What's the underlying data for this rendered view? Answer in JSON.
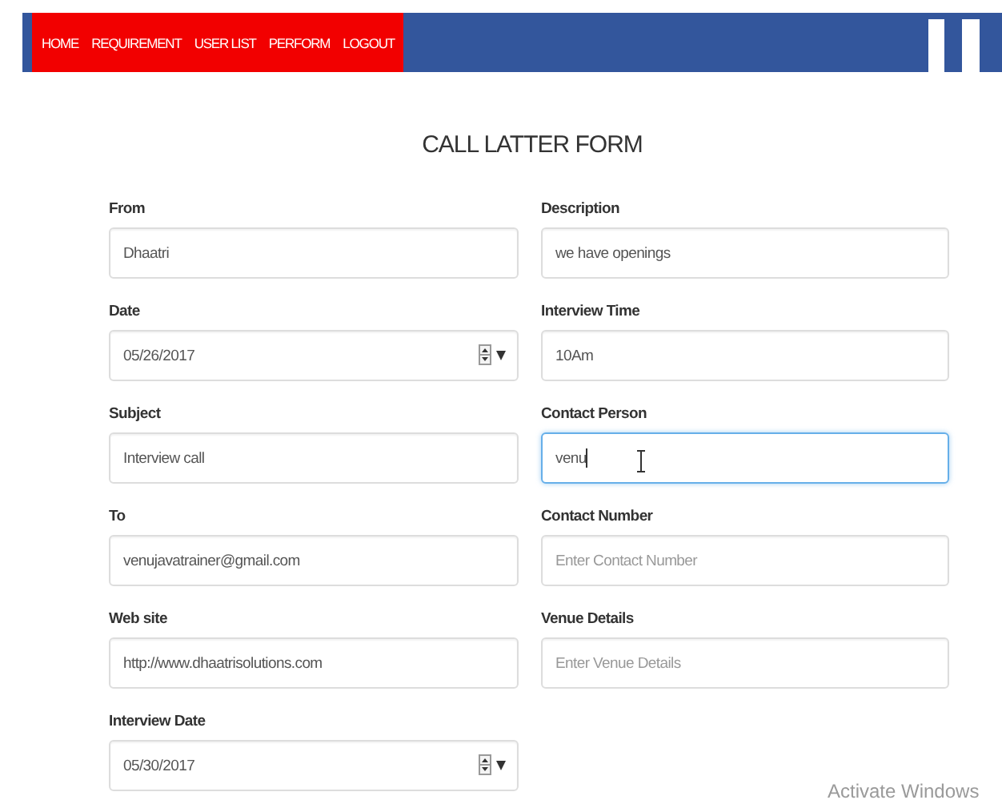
{
  "nav": {
    "items": [
      {
        "label": "HOME"
      },
      {
        "label": "REQUIREMENT"
      },
      {
        "label": "USER LIST"
      },
      {
        "label": "PERFORM"
      },
      {
        "label": "LOGOUT"
      }
    ]
  },
  "form": {
    "title": "CALL LATTER FORM",
    "fields": [
      {
        "label": "From",
        "kind": "text",
        "value": "Dhaatri",
        "focused": false,
        "mouse_pointer": false
      },
      {
        "label": "Description",
        "kind": "text",
        "value": "we have openings",
        "focused": false,
        "mouse_pointer": false
      },
      {
        "label": "Date",
        "kind": "date",
        "value": "05/26/2017",
        "focused": false,
        "mouse_pointer": false
      },
      {
        "label": "Interview Time",
        "kind": "text",
        "value": "10Am",
        "focused": false,
        "mouse_pointer": false
      },
      {
        "label": "Subject",
        "kind": "text",
        "value": "Interview call",
        "focused": false,
        "mouse_pointer": false
      },
      {
        "label": "Contact Person",
        "kind": "text",
        "value": "venu",
        "focused": true,
        "mouse_pointer": true
      },
      {
        "label": "To",
        "kind": "text",
        "value": "venujavatrainer@gmail.com",
        "focused": false,
        "mouse_pointer": false
      },
      {
        "label": "Contact Number",
        "kind": "text",
        "placeholder": "Enter Contact Number",
        "focused": false,
        "mouse_pointer": false
      },
      {
        "label": "Web site",
        "kind": "text",
        "value": "http://www.dhaatrisolutions.com",
        "focused": false,
        "mouse_pointer": false
      },
      {
        "label": "Venue Details",
        "kind": "text",
        "placeholder": "Enter Venue Details",
        "focused": false,
        "mouse_pointer": false
      },
      {
        "label": "Interview Date",
        "kind": "date",
        "value": "05/30/2017",
        "focused": false,
        "mouse_pointer": false
      }
    ]
  },
  "os_notice": "Activate Windows"
}
